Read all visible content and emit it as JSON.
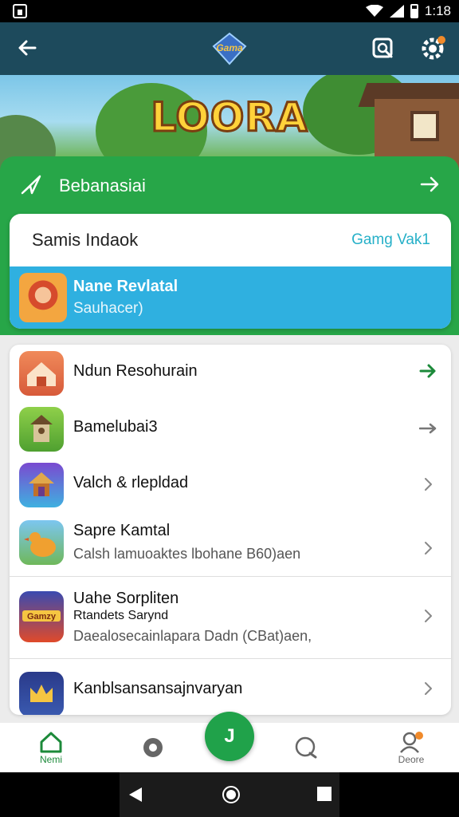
{
  "status_bar": {
    "time": "1:18",
    "icons": [
      "notification-icon",
      "wifi-icon",
      "signal-icon",
      "battery-icon"
    ]
  },
  "app_bar": {
    "logo_text": "Gama",
    "icons": [
      "back-arrow-icon",
      "search-icon",
      "settings-icon"
    ]
  },
  "hero": {
    "title": "LOORA"
  },
  "green_card": {
    "title": "Bebanasiai",
    "icon": "send-icon",
    "action_icon": "arrow-right-icon"
  },
  "panel": {
    "title": "Samis Indaok",
    "link": "Gamg Vak1",
    "highlight": {
      "title": "Nane Revlatal",
      "subtitle": "Sauhacer)"
    }
  },
  "list": [
    {
      "title": "Ndun Resohurain",
      "subtitle": "",
      "icon": "house-icon",
      "action": "arrow-green"
    },
    {
      "title": "Bamelubai3",
      "subtitle": "",
      "icon": "tower-icon",
      "action": "arrow-gray"
    },
    {
      "title": "Valch & rlepldad",
      "subtitle": "",
      "icon": "shrine-icon",
      "action": "chevron"
    },
    {
      "title": "Sapre Kamtal",
      "subtitle": "Calsh lamuoaktes lbohane B60)aen",
      "icon": "chicken-icon",
      "action": "chevron"
    },
    {
      "title": "Uahe Sorpliten",
      "title2": "Rtandets Sarynd",
      "subtitle": "Daealosecainlapara Dadn (CBat)aen,",
      "icon": "gamzy-icon",
      "icon_text": "Gamzy",
      "action": "chevron"
    },
    {
      "title": "Kanblsansansajnvaryan",
      "subtitle": "",
      "icon": "crown-icon",
      "action": "chevron"
    }
  ],
  "bottom_nav": {
    "items": [
      {
        "label": "Nemi",
        "icon": "home-icon"
      },
      {
        "label": "",
        "icon": "record-icon"
      },
      {
        "label": "",
        "icon": "chat-icon"
      },
      {
        "label": "Deore",
        "icon": "profile-icon"
      }
    ],
    "fab_label": "J"
  },
  "colors": {
    "app_bar": "#1d4a5c",
    "green": "#27a648",
    "highlight": "#2fb0e0",
    "link": "#26b0c8"
  }
}
